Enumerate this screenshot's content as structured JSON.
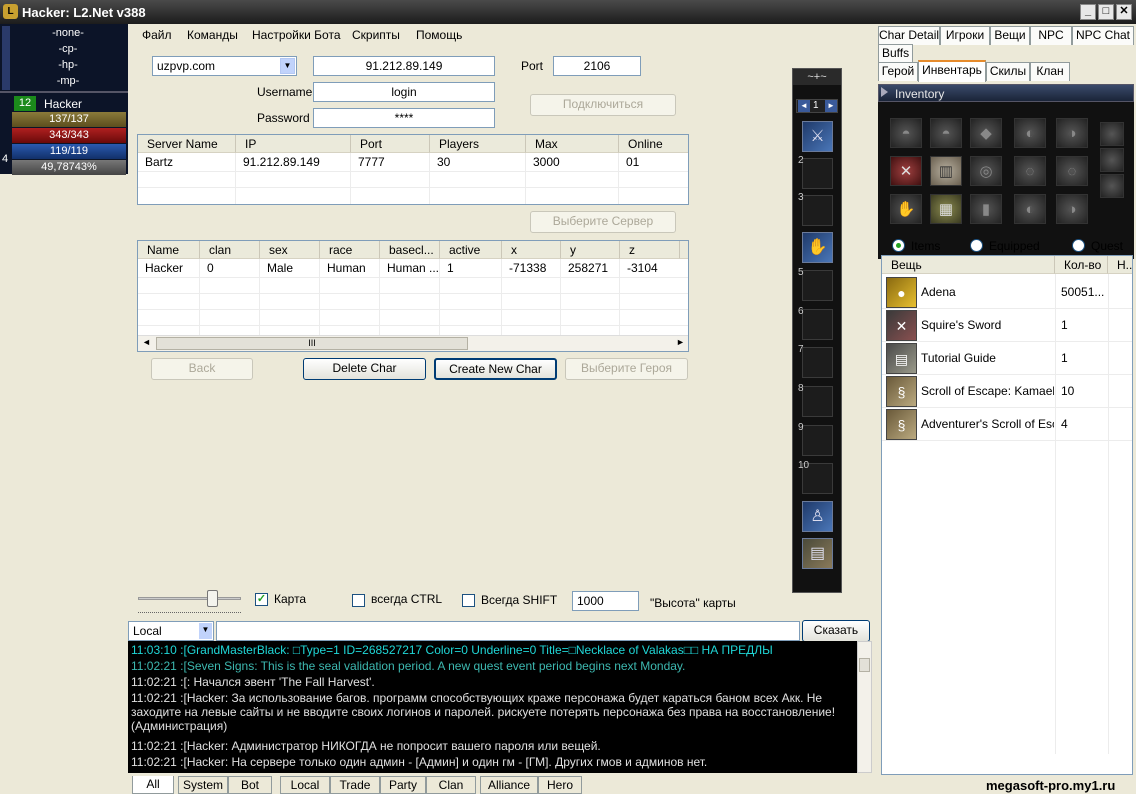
{
  "window": {
    "title": "Hacker: L2.Net v388",
    "logo": "L",
    "min": "_",
    "max": "□",
    "close": "✕"
  },
  "left_panel": {
    "target": [
      "-none-",
      "-cp-",
      "-hp-",
      "-mp-"
    ],
    "level": "12",
    "name": "Hacker",
    "cp": "137/137",
    "hp": "343/343",
    "mp": "119/119",
    "xp": "49,78743%",
    "party_index": "4"
  },
  "menu": [
    "Файл",
    "Команды",
    "Настройки Бота",
    "Скрипты",
    "Помощь"
  ],
  "login": {
    "server_select": "uzpvp.com",
    "ip": "91.212.89.149",
    "port_label": "Port",
    "port": "2106",
    "username_label": "Username",
    "username": "login",
    "password_label": "Password",
    "password": "****",
    "connect_btn": "Подключиться"
  },
  "servers": {
    "headers": [
      "Server Name",
      "IP",
      "Port",
      "Players",
      "Max",
      "Online"
    ],
    "rows": [
      [
        "Bartz",
        "91.212.89.149",
        "7777",
        "30",
        "3000",
        "01"
      ]
    ],
    "select_btn": "Выберите Сервер"
  },
  "chars": {
    "headers": [
      "Name",
      "clan",
      "sex",
      "race",
      "basecl...",
      "active",
      "x",
      "y",
      "z"
    ],
    "rows": [
      [
        "Hacker",
        "0",
        "Male",
        "Human",
        "Human ...",
        "1",
        "-71338",
        "258271",
        "-3104"
      ]
    ],
    "scroll_thumb": "III",
    "back_btn": "Back",
    "delete_btn": "Delete Char",
    "create_btn": "Create New Char",
    "select_btn": "Выберите Героя"
  },
  "hotbar": {
    "header": "~+~",
    "page": "1",
    "prev": "◄",
    "next": "►",
    "slots": [
      "",
      "2",
      "3",
      "",
      "5",
      "6",
      "7",
      "8",
      "9",
      "10",
      "",
      ""
    ]
  },
  "options": {
    "map_label": "Карта",
    "ctrl_label": "всегда CTRL",
    "shift_label": "Всегда SHIFT",
    "height_value": "1000",
    "height_label": "\"Высота\" карты",
    "check_mark": "✓"
  },
  "chat": {
    "channel": "Local",
    "say_btn": "Сказать",
    "lines": [
      {
        "text": "11:03:10  :[GrandMasterBlack: □Type=1  ID=268527217  Color=0  Underline=0  Title=□Necklace of Valakas□□  НА ПРЕДЛЫ",
        "color": "#1fd6d6"
      },
      {
        "text": "11:02:21  :[Seven Signs: This is the seal validation period. A new quest event period begins next Monday.",
        "color": "#3db8b0"
      },
      {
        "text": "11:02:21  :[: Начался эвент 'The Fall Harvest'.",
        "color": "#e0e0e0"
      },
      {
        "text": "11:02:21  :[Hacker: За использование багов. программ способствующих краже персонажа будет караться баном всех Акк. Не заходите на левые сайты и не вводите своих логинов и паролей. рискуете потерять персонажа без права на восстановление! (Администрация)",
        "color": "#e0e0e0"
      },
      {
        "text": "11:02:21  :[Hacker: Администратор НИКОГДА не попросит вашего пароля или вещей.",
        "color": "#e0e0e0"
      },
      {
        "text": "11:02:21  :[Hacker: На сервере только один админ - [Админ] и один гм - [ГМ]. Других гмов и админов нет.",
        "color": "#e0e0e0"
      }
    ]
  },
  "chat_tabs": [
    "All",
    "System",
    "Bot",
    "Local",
    "Trade",
    "Party",
    "Clan",
    "Alliance",
    "Hero"
  ],
  "right_tabs": {
    "row1": [
      "Char Detail",
      "Игроки",
      "Вещи",
      "NPC",
      "NPC Chat"
    ],
    "row2": [
      "Buffs"
    ],
    "row3": [
      "Герой",
      "Инвентарь",
      "Скилы",
      "Клан"
    ]
  },
  "inventory": {
    "title": "Inventory",
    "filters": [
      "Items",
      "Equipped",
      "Quest"
    ],
    "headers": [
      "Вещь",
      "Кол-во",
      "Н.."
    ],
    "items": [
      {
        "name": "Adena",
        "qty": "50051...",
        "icon": "●"
      },
      {
        "name": "Squire's Sword",
        "qty": "1",
        "icon": "✕"
      },
      {
        "name": "Tutorial Guide",
        "qty": "1",
        "icon": "▤"
      },
      {
        "name": "Scroll of Escape: Kamael ...",
        "qty": "10",
        "icon": "§"
      },
      {
        "name": "Adventurer's Scroll of Esc...",
        "qty": "4",
        "icon": "§"
      }
    ]
  },
  "watermark": "megasoft-pro.my1.ru"
}
